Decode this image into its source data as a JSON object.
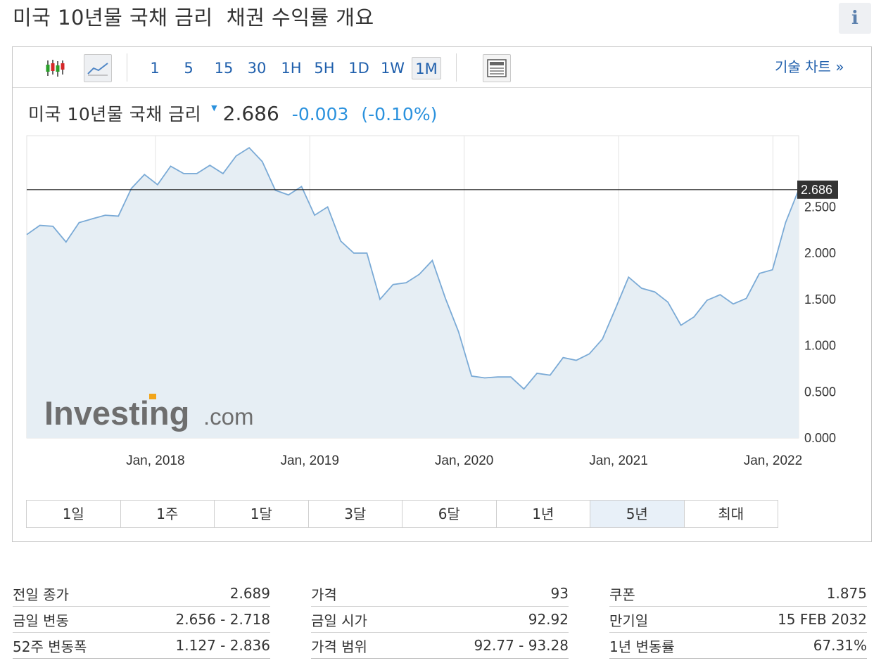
{
  "page_title": "미국 10년물 국채 금리  채권 수익률 개요",
  "info_icon": "i",
  "toolbar": {
    "icons": [
      "candlestick-icon",
      "line-chart-icon",
      "news-icon"
    ],
    "intervals": [
      "1",
      "5",
      "15",
      "30",
      "1H",
      "5H",
      "1D",
      "1W",
      "1M"
    ],
    "active_interval": "1M",
    "tech_chart_link": "기술 차트 »"
  },
  "quote": {
    "name": "미국 10년물 국채 금리",
    "price": "2.686",
    "change": "-0.003",
    "change_pct": "(-0.10%)",
    "direction": "down",
    "change_color": "#2a91dd"
  },
  "watermark": {
    "brand": "Investing",
    "suffix": ".com"
  },
  "chart_data": {
    "type": "area",
    "x_tick_labels": [
      "Jan, 2018",
      "Jan, 2019",
      "Jan, 2020",
      "Jan, 2021",
      "Jan, 2022"
    ],
    "y_tick_labels": [
      "0.000",
      "0.500",
      "1.000",
      "1.500",
      "2.000",
      "2.500"
    ],
    "y_ticks": [
      0,
      0.5,
      1.0,
      1.5,
      2.0,
      2.5
    ],
    "ylim": [
      0,
      3.27
    ],
    "x_start": "2017-03",
    "x_end": "2022-03",
    "current_value_label": "2.686",
    "current_value": 2.686,
    "grid": "vertical",
    "line_color": "#7aaad6",
    "fill_color": "#e6eef4",
    "series": [
      {
        "values": [
          2.2,
          2.3,
          2.29,
          2.12,
          2.33,
          2.37,
          2.41,
          2.4,
          2.7,
          2.85,
          2.74,
          2.94,
          2.86,
          2.86,
          2.95,
          2.86,
          3.05,
          3.14,
          2.99,
          2.68,
          2.63,
          2.72,
          2.41,
          2.5,
          2.13,
          2.0,
          2.0,
          1.5,
          1.66,
          1.68,
          1.77,
          1.92,
          1.51,
          1.15,
          0.67,
          0.65,
          0.66,
          0.66,
          0.53,
          0.7,
          0.68,
          0.87,
          0.84,
          0.91,
          1.07,
          1.4,
          1.74,
          1.62,
          1.58,
          1.47,
          1.22,
          1.31,
          1.49,
          1.55,
          1.45,
          1.51,
          1.78,
          1.82,
          2.33,
          2.686
        ]
      }
    ]
  },
  "range_buttons": [
    "1일",
    "1주",
    "1달",
    "3달",
    "6달",
    "1년",
    "5년",
    "최대"
  ],
  "active_range": "5년",
  "stats": [
    [
      {
        "label": "전일 종가",
        "value": "2.689"
      },
      {
        "label": "금일 변동",
        "value": "2.656 - 2.718"
      },
      {
        "label": "52주 변동폭",
        "value": "1.127 - 2.836"
      }
    ],
    [
      {
        "label": "가격",
        "value": "93"
      },
      {
        "label": "금일 시가",
        "value": "92.92"
      },
      {
        "label": "가격 범위",
        "value": "92.77 - 93.28"
      }
    ],
    [
      {
        "label": "쿠폰",
        "value": "1.875"
      },
      {
        "label": "만기일",
        "value": "15 FEB 2032"
      },
      {
        "label": "1년 변동률",
        "value": "67.31%"
      }
    ]
  ]
}
